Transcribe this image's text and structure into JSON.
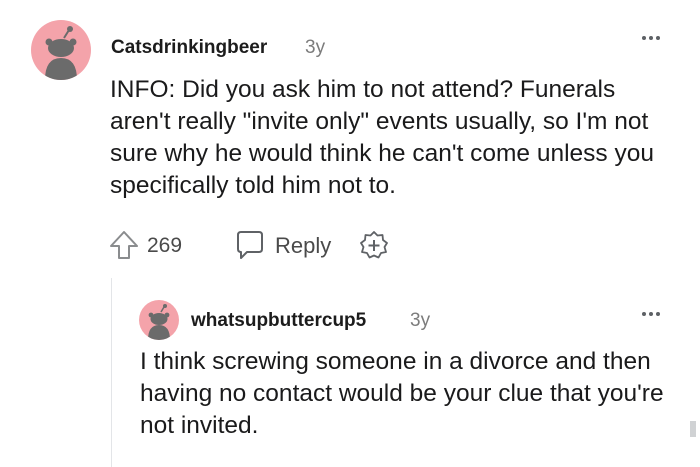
{
  "comments": [
    {
      "author": "Catsdrinkingbeer",
      "age": "3y",
      "body": "INFO: Did you ask him to not attend? Funerals aren't really \"invite only\" events usually, so I'm not sure why he would think he can't come unless you specifically told him not to.",
      "score": "269",
      "reply_label": "Reply",
      "icons": [
        "avatar-icon",
        "upvote-icon",
        "reply-icon",
        "award-icon",
        "more-options-icon"
      ]
    },
    {
      "author": "whatsupbuttercup5",
      "age": "3y",
      "body": "I think screwing someone in a divorce and then having no contact would be your clue that you're not invited.",
      "icons": [
        "avatar-icon",
        "more-options-icon"
      ]
    }
  ],
  "colors": {
    "avatar_bg": "#f4a3aa",
    "avatar_figure": "#6b6b6b",
    "text": "#1a1a1b",
    "muted": "#7c7c7c",
    "thread_line": "#e3e5e8"
  }
}
